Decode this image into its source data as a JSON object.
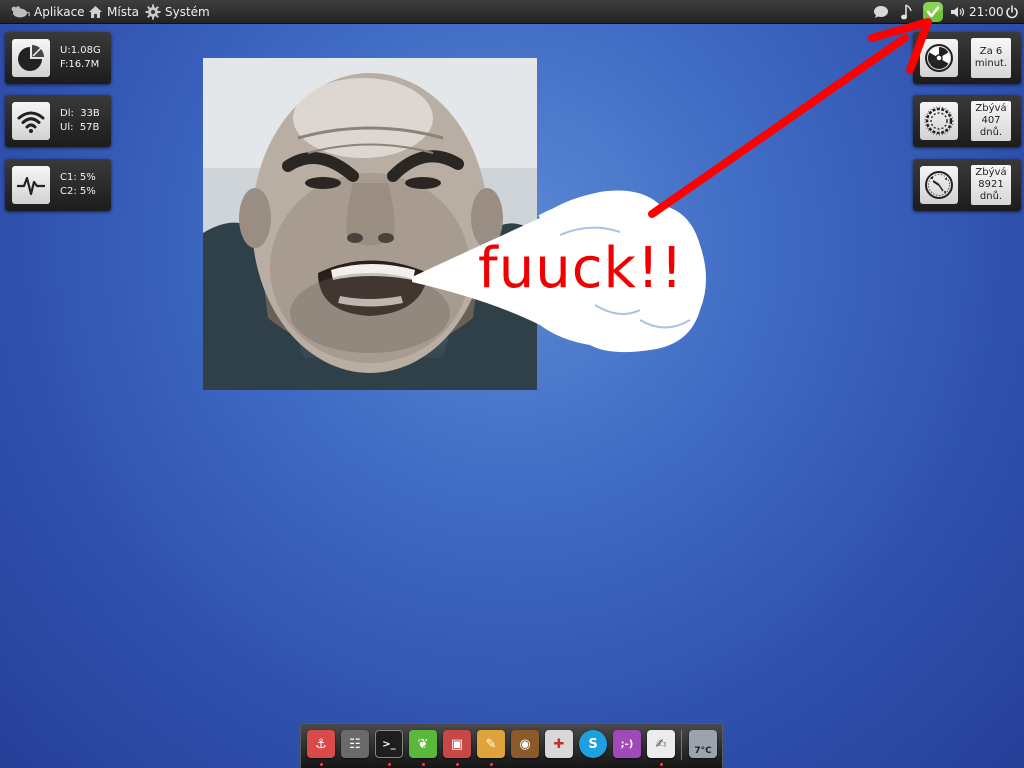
{
  "top_panel": {
    "menus": [
      "Aplikace",
      "Místa",
      "Systém"
    ],
    "clock": "21:00",
    "tray_icons": [
      "chat-bubble-icon",
      "music-note-icon",
      "update-shield-icon",
      "volume-icon",
      "power-icon"
    ]
  },
  "widgets_left": [
    {
      "icon": "disk-usage-icon",
      "lines": [
        "U:1.08G",
        "F:16.7M"
      ]
    },
    {
      "icon": "wifi-icon",
      "lines": [
        "Dl:  33B",
        "Ul:  57B"
      ]
    },
    {
      "icon": "cpu-pulse-icon",
      "lines": [
        "C1: 5%",
        "C2: 5%"
      ]
    }
  ],
  "widgets_right": [
    {
      "icon": "radiation-icon",
      "lines": [
        "Za 6",
        "minut."
      ]
    },
    {
      "icon": "ring-doodle-icon",
      "lines": [
        "Zbývá",
        "407",
        "dnů."
      ]
    },
    {
      "icon": "clock-doodle-icon",
      "lines": [
        "Zbývá",
        "8921",
        "dnů."
      ]
    }
  ],
  "overlay": {
    "speech_text": "fuuck!!",
    "arrow_color": "#ff0000"
  },
  "dock": {
    "items": [
      {
        "name": "anchor-app-icon",
        "glyph": "⚓",
        "color": "#d94a4a"
      },
      {
        "name": "mixer-app-icon",
        "glyph": "☷",
        "color": "#6a6a6a"
      },
      {
        "name": "terminal-app-icon",
        "glyph": ">_",
        "color": "#1e1e1e"
      },
      {
        "name": "leaf-app-icon",
        "glyph": "❦",
        "color": "#5cb83a"
      },
      {
        "name": "screenshot-app-icon",
        "glyph": "▣",
        "color": "#c84848"
      },
      {
        "name": "paint-app-icon",
        "glyph": "✎",
        "color": "#e0a23a"
      },
      {
        "name": "speaker-app-icon",
        "glyph": "◉",
        "color": "#8a5a2a"
      },
      {
        "name": "games-app-icon",
        "glyph": "✚",
        "color": "#d8d8d8"
      },
      {
        "name": "skype-app-icon",
        "glyph": "S",
        "color": "#1ea0e0"
      },
      {
        "name": "chat-app-icon",
        "glyph": ";-)",
        "color": "#a04ab8"
      },
      {
        "name": "notes-app-icon",
        "glyph": "✍",
        "color": "#ececec"
      },
      {
        "name": "weather-app-icon",
        "glyph": "7°C",
        "color": "#9aa4ae"
      }
    ]
  }
}
